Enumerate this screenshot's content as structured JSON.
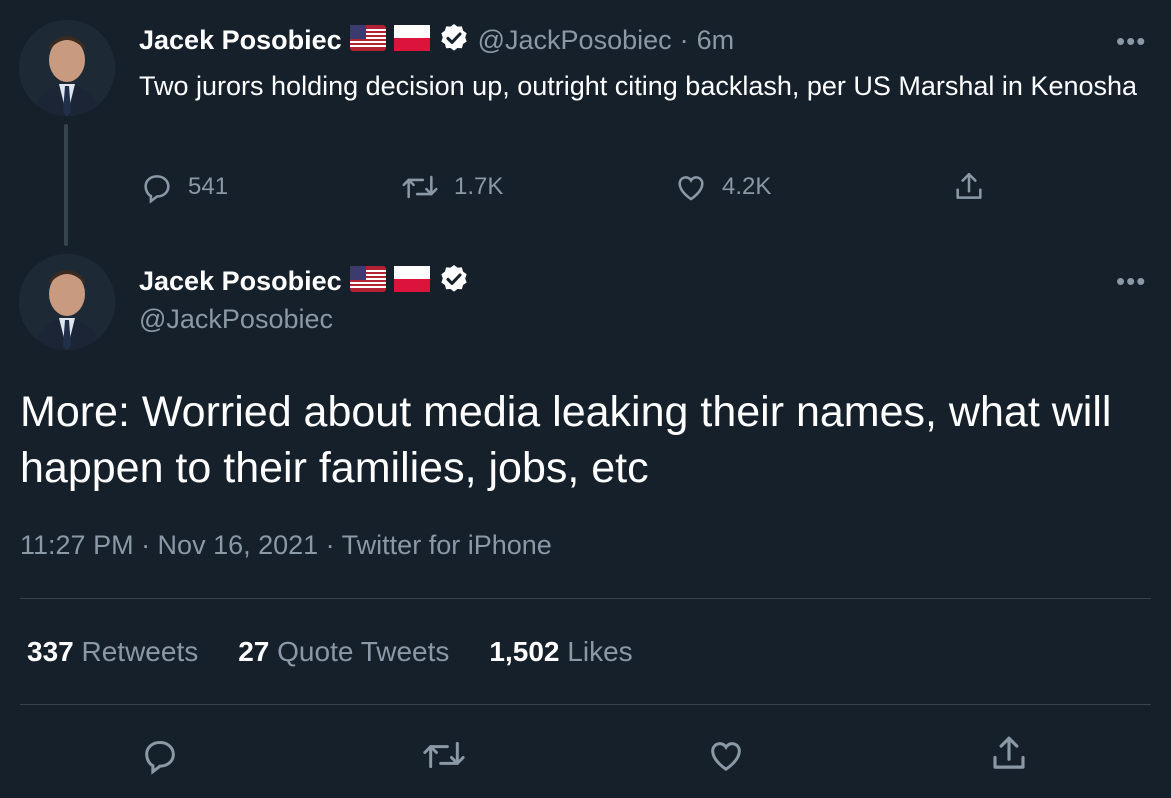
{
  "tweet1": {
    "name": "Jacek Posobiec",
    "handle": "@JackPosobiec",
    "separator": "·",
    "time": "6m",
    "text": "Two jurors holding decision up, outright citing backlash, per US Marshal in Kenosha",
    "replies": "541",
    "retweets": "1.7K",
    "likes": "4.2K",
    "more": "•••"
  },
  "tweet2": {
    "name": "Jacek Posobiec",
    "handle": "@JackPosobiec",
    "text": "More: Worried about media leaking their names, what will happen to their families, jobs, etc",
    "meta": "11:27 PM · Nov 16, 2021 · Twitter for iPhone",
    "more": "•••"
  },
  "stats": {
    "retweets_count": "337",
    "retweets_label": "Retweets",
    "quotes_count": "27",
    "quotes_label": "Quote Tweets",
    "likes_count": "1,502",
    "likes_label": "Likes"
  },
  "colors": {
    "background": "#15202b",
    "muted": "#8b98a5",
    "divider": "#38444d"
  },
  "icons": [
    "us-flag-icon",
    "poland-flag-icon",
    "verified-badge-icon",
    "reply-icon",
    "retweet-icon",
    "like-icon",
    "share-icon",
    "more-icon"
  ]
}
